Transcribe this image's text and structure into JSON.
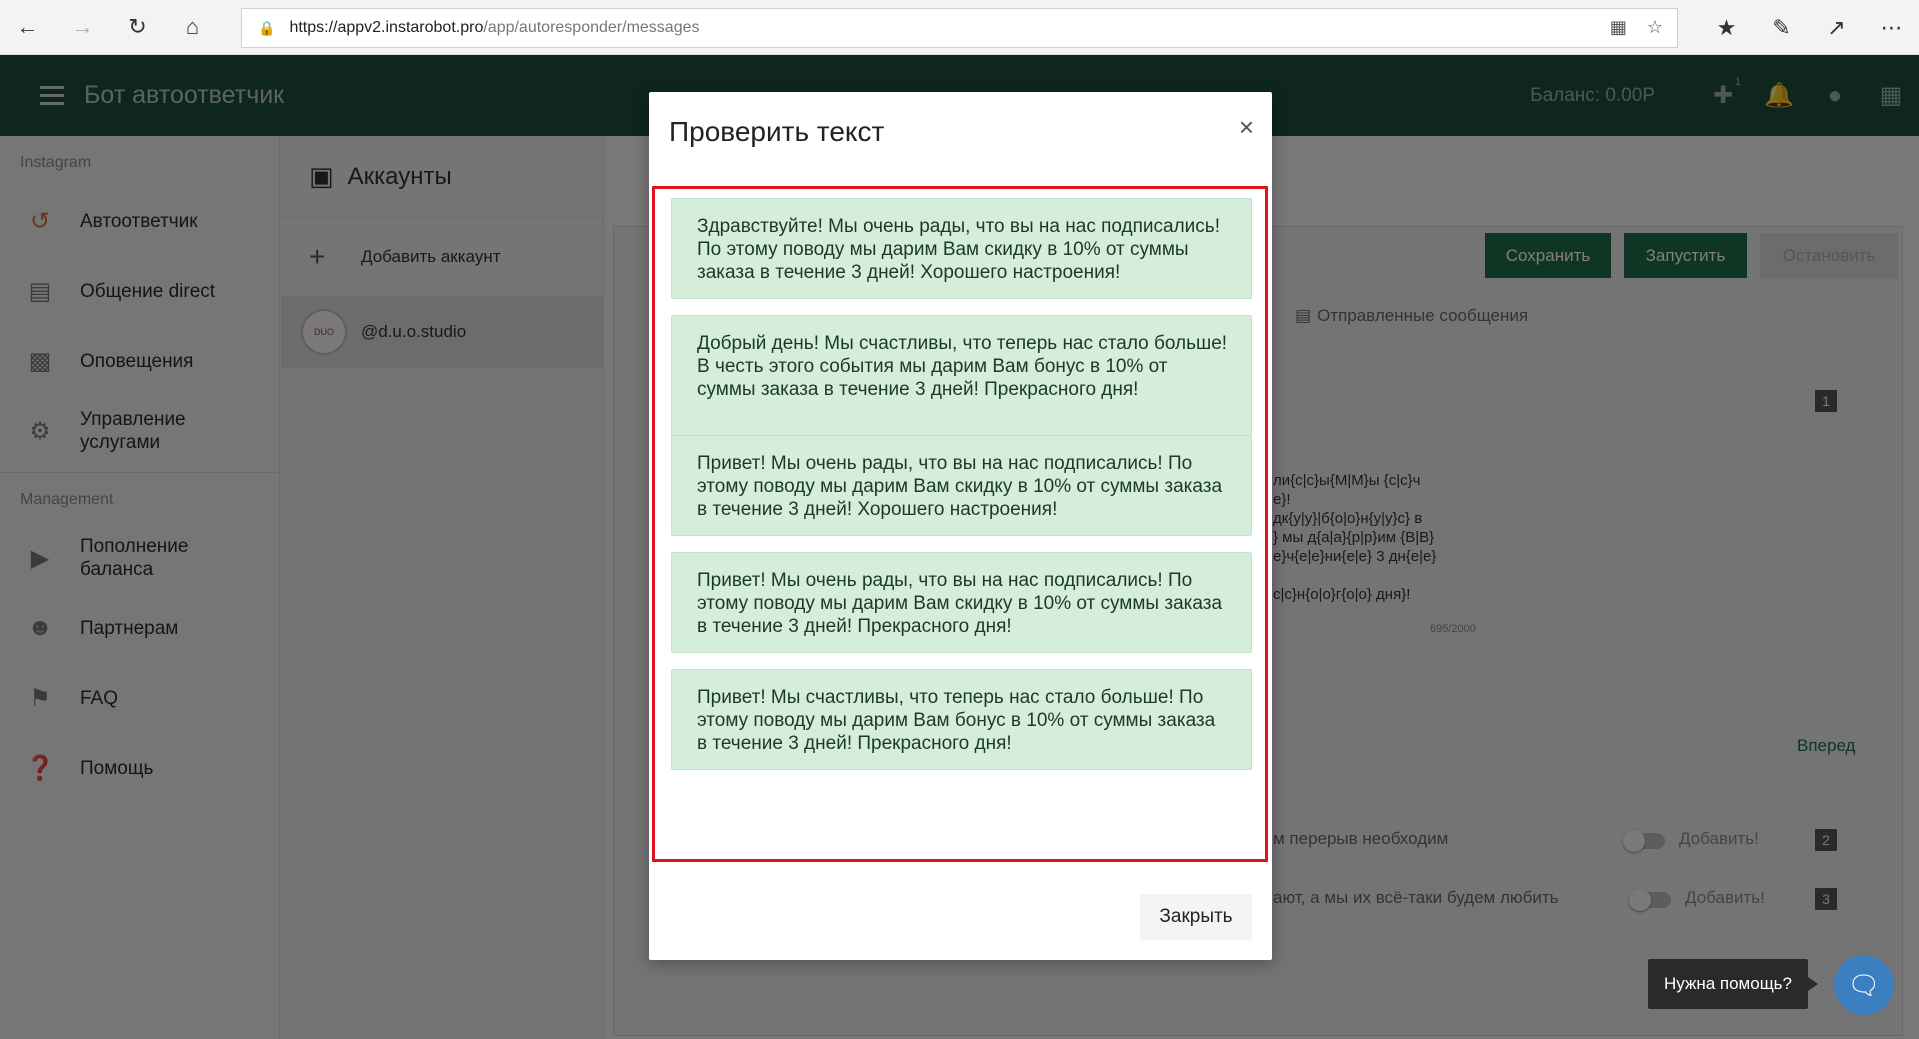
{
  "browser": {
    "url_host": "https://appv2.instarobot.pro",
    "url_path": "/app/autoresponder/messages"
  },
  "header": {
    "title": "Бот автоответчик",
    "balance": "Баланс: 0.00Р",
    "notif_badge": "1"
  },
  "sidebar": {
    "section_instagram": "Instagram",
    "section_management": "Management",
    "items": [
      {
        "label": "Автоответчик",
        "icon": "history-icon"
      },
      {
        "label": "Общение direct",
        "icon": "chat-icon"
      },
      {
        "label": "Оповещения",
        "icon": "building-icon"
      },
      {
        "label": "Управление услугами",
        "icon": "gear-icon"
      },
      {
        "label": "Пополнение баланса",
        "icon": "wallet-icon"
      },
      {
        "label": "Партнерам",
        "icon": "contact-icon"
      },
      {
        "label": "FAQ",
        "icon": "alert-icon"
      },
      {
        "label": "Помощь",
        "icon": "help-icon"
      }
    ]
  },
  "accounts": {
    "title": "Аккаунты",
    "add_label": "Добавить аккаунт",
    "account_name": "@d.u.o.studio"
  },
  "main": {
    "save": "Сохранить",
    "run": "Запустить",
    "stop": "Остановить",
    "sent_tab": "Отправленные сообщения",
    "badge1": "1",
    "badge2": "2",
    "badge3": "3",
    "textarea_lines": [
      "ли{c|c}ы{M|M}ы {c|c}ч",
      "е}!",
      "дк{y|y}|б{o|o}н{y|y}c} в",
      "} мы д{а|а}{p|p}им {В|В}",
      "е}ч{е|е}ни{е|е} 3 дн{е|е}",
      "",
      "c|c}н{o|o}г{o|o} дня}!"
    ],
    "char_count": "695/2000",
    "forward": "Вперед",
    "row2_text": "м перерыв необходим",
    "row3_text": "ают, а мы их всё-таки будем любить",
    "add_label": "Добавить!"
  },
  "modal": {
    "title": "Проверить текст",
    "close_label": "Закрыть",
    "messages": [
      "Здравствуйте! Мы очень рады, что вы на нас подписались! По этому поводу мы дарим Вам скидку в 10% от суммы заказа в течение 3 дней! Хорошего настроения!",
      "Добрый день! Мы счастливы, что теперь нас стало больше! В честь этого события мы дарим Вам бонус в 10% от суммы заказа в течение 3 дней! Прекрасного дня!",
      "Привет! Мы очень рады, что вы на нас подписались! По этому поводу мы дарим Вам скидку в 10% от суммы заказа в течение 3 дней! Хорошего настроения!",
      "Привет! Мы очень рады, что вы на нас подписались! По этому поводу мы дарим Вам скидку в 10% от суммы заказа в течение 3 дней! Прекрасного дня!",
      "Привет! Мы счастливы, что теперь нас стало больше! По этому поводу мы дарим Вам бонус в 10% от суммы заказа в течение 3 дней! Прекрасного дня!"
    ]
  },
  "help": {
    "label": "Нужна помощь?"
  },
  "colors": {
    "header_bg": "#1d4d3a",
    "primary_button": "#1f6a48",
    "message_bg": "#d4eed9",
    "highlight": "#e0141e"
  }
}
